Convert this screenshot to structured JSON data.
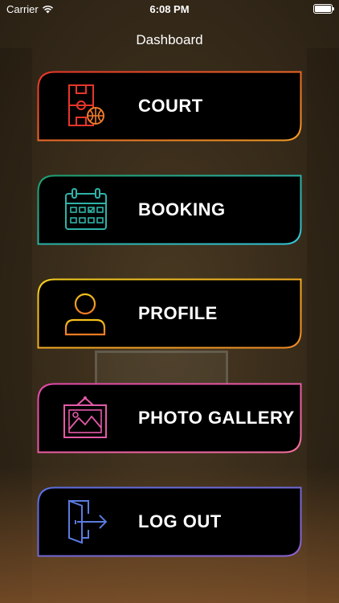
{
  "status_bar": {
    "carrier": "Carrier",
    "time": "6:08 PM"
  },
  "nav": {
    "title": "Dashboard"
  },
  "menu": [
    {
      "label": "COURT",
      "icon": "basketball-court-icon",
      "colors": [
        "#e8352b",
        "#f39c24"
      ]
    },
    {
      "label": "BOOKING",
      "icon": "calendar-icon",
      "colors": [
        "#1f9e6e",
        "#36c5d9"
      ]
    },
    {
      "label": "PROFILE",
      "icon": "user-icon",
      "colors": [
        "#f5d020",
        "#f08a24"
      ]
    },
    {
      "label": "PHOTO GALLERY",
      "icon": "photo-frame-icon",
      "colors": [
        "#e24aa8",
        "#f56fa1"
      ]
    },
    {
      "label": "LOG OUT",
      "icon": "logout-icon",
      "colors": [
        "#5a6fe0",
        "#8a63d2"
      ]
    }
  ]
}
